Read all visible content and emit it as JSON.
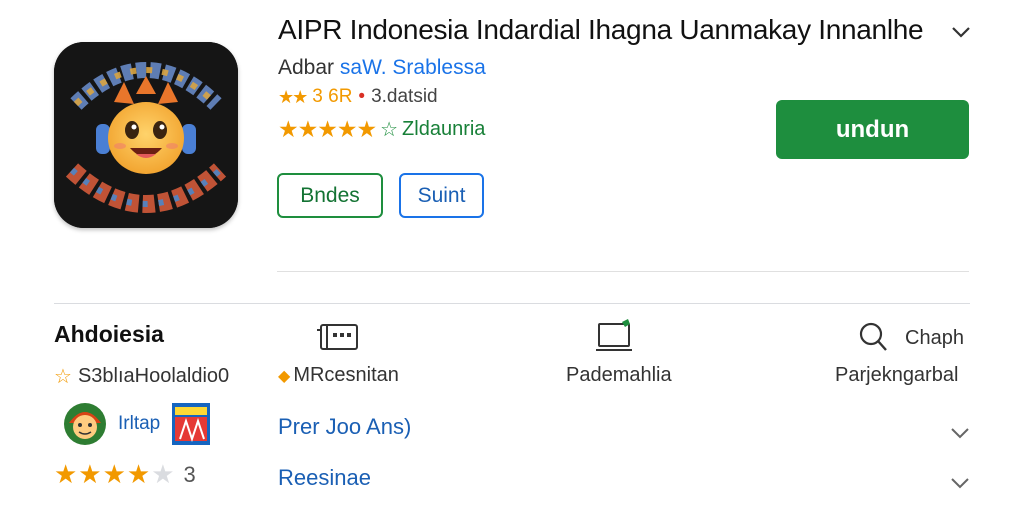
{
  "header": {
    "title": "AIPR Indonesia Indardial Ihagna Uanmakay  Innanlhe",
    "developer_prefix": "Adbar",
    "developer_link": "saW. Srablessa",
    "rating_line": "3  6R",
    "rating_dot": "•",
    "rating_extra": "3.datsid",
    "rating_label": "Zldaunria",
    "primary_button": "undun",
    "secondary_button_1": "Bndes",
    "secondary_button_2": "Suint"
  },
  "details": {
    "section_title": "Ahdoiesia",
    "col1_label": "S3blıaHoolaldio0",
    "col2_label": "MRcesnitan",
    "col3_label": "Pademahlia",
    "col4_top": "Chaph",
    "col4_label": "Parjekngarbal",
    "row1_tag": "Irltap",
    "row1_link": "Prer Joo Ans)",
    "rating_count": "3",
    "row2_link": "Reesinae"
  },
  "icons": {
    "title_chevron": "chevron-down-icon",
    "info_icon_1": "film-icon",
    "info_icon_2": "monitor-icon",
    "info_icon_3": "search-icon",
    "row_chevron": "chevron-down-icon"
  },
  "colors": {
    "accent_green": "#1e8e3e",
    "accent_blue": "#1a73e8",
    "star": "#f29900"
  },
  "ratings": {
    "header_stars": 5,
    "review_stars": 4
  }
}
